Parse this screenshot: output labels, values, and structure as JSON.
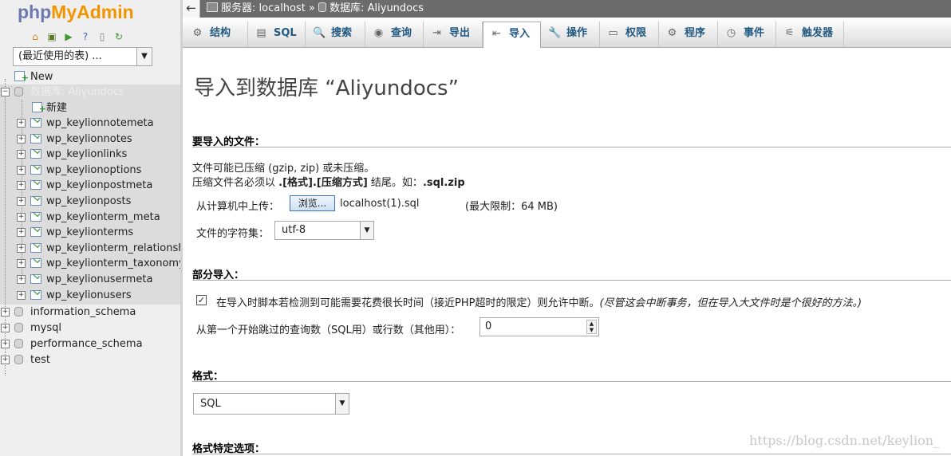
{
  "app": {
    "logo_php": "php",
    "logo_myadmin": "MyAdmin"
  },
  "nav": {
    "icons": [
      "home-icon",
      "exit-icon",
      "sql-icon",
      "help-icon",
      "docs-icon",
      "reload-icon"
    ],
    "recent_tables": "(最近使用的表) ...",
    "new_label": "New",
    "db_new_label": "新建",
    "tables": [
      "wp_keylionnotemeta",
      "wp_keylionnotes",
      "wp_keylionlinks",
      "wp_keylionoptions",
      "wp_keylionpostmeta",
      "wp_keylionposts",
      "wp_keylionterm_meta",
      "wp_keylionterms",
      "wp_keylionterm_relationships",
      "wp_keylionterm_taxonomy",
      "wp_keylionusermeta",
      "wp_keylionusers"
    ],
    "databases": [
      "information_schema",
      "mysql",
      "performance_schema",
      "test"
    ]
  },
  "topbar": {
    "collapse": "←",
    "server_label": "服务器: localhost",
    "separator": "»",
    "db_label": "数据库: Aliyundocs"
  },
  "tabs": [
    {
      "id": "structure",
      "label": "结构",
      "icon": "structure-icon",
      "glyph": "⚙"
    },
    {
      "id": "sql",
      "label": "SQL",
      "icon": "sql-icon",
      "glyph": "▤"
    },
    {
      "id": "search",
      "label": "搜索",
      "icon": "search-icon",
      "glyph": "🔍"
    },
    {
      "id": "query",
      "label": "查询",
      "icon": "query-icon",
      "glyph": "◉"
    },
    {
      "id": "export",
      "label": "导出",
      "icon": "export-icon",
      "glyph": "⇥"
    },
    {
      "id": "import",
      "label": "导入",
      "icon": "import-icon",
      "glyph": "⇤"
    },
    {
      "id": "operations",
      "label": "操作",
      "icon": "wrench-icon",
      "glyph": "🔧"
    },
    {
      "id": "privileges",
      "label": "权限",
      "icon": "privileges-icon",
      "glyph": "▭"
    },
    {
      "id": "routines",
      "label": "程序",
      "icon": "routines-icon",
      "glyph": "⚙"
    },
    {
      "id": "events",
      "label": "事件",
      "icon": "clock-icon",
      "glyph": "◷"
    },
    {
      "id": "triggers",
      "label": "触发器",
      "icon": "triggers-icon",
      "glyph": "⚟"
    }
  ],
  "active_tab": "import",
  "main": {
    "title": "导入到数据库 “Aliyundocs”",
    "file_section": {
      "heading": "要导入的文件：",
      "note1": "文件可能已压缩 (gzip, zip) 或未压缩。",
      "note2_prefix": "压缩文件名必须以 ",
      "note2_format": ".[格式].[压缩方式]",
      "note2_mid": " 结尾。如：",
      "note2_example": ".sql.zip",
      "upload_label": "从计算机中上传：",
      "browse_button": "浏览...",
      "file_name": "localhost(1).sql",
      "max_limit": "(最大限制：64 MB)",
      "charset_label": "文件的字符集：",
      "charset_value": "utf-8"
    },
    "partial_section": {
      "heading": "部分导入：",
      "allow_interrupt": "在导入时脚本若检测到可能需要花费很长时间（接近PHP超时的限定）则允许中断。",
      "allow_interrupt_note": "(尽管这会中断事务，但在导入大文件时是个很好的方法。)",
      "allow_interrupt_checked": "✓",
      "skip_label": "从第一个开始跳过的查询数（SQL用）或行数（其他用）：",
      "skip_value": "0"
    },
    "format_section": {
      "heading": "格式：",
      "format_value": "SQL"
    },
    "format_options_section": {
      "heading": "格式特定选项："
    }
  },
  "watermark": "https://blog.csdn.net/keylion_"
}
